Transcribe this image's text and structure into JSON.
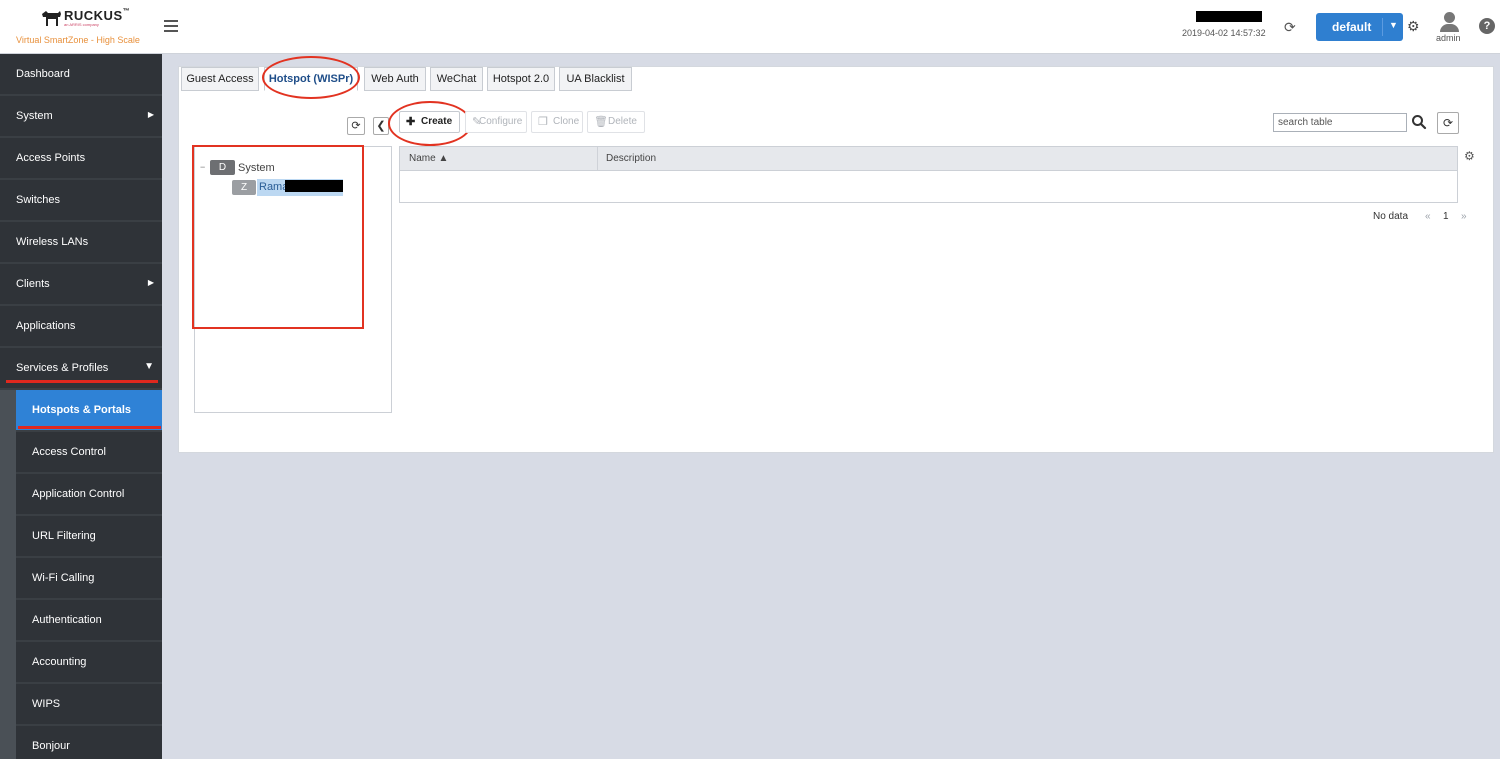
{
  "header": {
    "logo_text": "RUCKUS",
    "logo_tm": "™",
    "logo_subtitle": "an ARRIS company",
    "app_name": "Virtual SmartZone - High Scale",
    "datetime": "2019-04-02  14:57:32",
    "domain_button": "default",
    "user": "admin",
    "help": "?"
  },
  "sidebar": {
    "items": [
      {
        "label": "Dashboard"
      },
      {
        "label": "System",
        "arrow": "▶"
      },
      {
        "label": "Access Points"
      },
      {
        "label": "Switches"
      },
      {
        "label": "Wireless LANs"
      },
      {
        "label": "Clients",
        "arrow": "▶"
      },
      {
        "label": "Applications"
      },
      {
        "label": "Services & Profiles",
        "arrow": "▼"
      }
    ],
    "sub_items": [
      {
        "label": "Hotspots & Portals"
      },
      {
        "label": "Access Control"
      },
      {
        "label": "Application Control"
      },
      {
        "label": "URL Filtering"
      },
      {
        "label": "Wi-Fi Calling"
      },
      {
        "label": "Authentication"
      },
      {
        "label": "Accounting"
      },
      {
        "label": "WIPS"
      },
      {
        "label": "Bonjour"
      }
    ]
  },
  "tabs": [
    "Guest Access",
    "Hotspot (WISPr)",
    "Web Auth",
    "WeChat",
    "Hotspot 2.0",
    "UA Blacklist"
  ],
  "tree": {
    "toggle": "−",
    "root_badge": "D",
    "root_label": "System",
    "zone_badge": "Z",
    "zone_label": "Rama"
  },
  "toolbar": {
    "create": "Create",
    "configure": "Configure",
    "clone": "Clone",
    "delete": "Delete",
    "search_placeholder": "search table"
  },
  "table": {
    "columns": [
      "Name ▲",
      "Description"
    ],
    "rows": []
  },
  "pager": {
    "status": "No data",
    "prev": "«",
    "page": "1",
    "next": "»"
  }
}
